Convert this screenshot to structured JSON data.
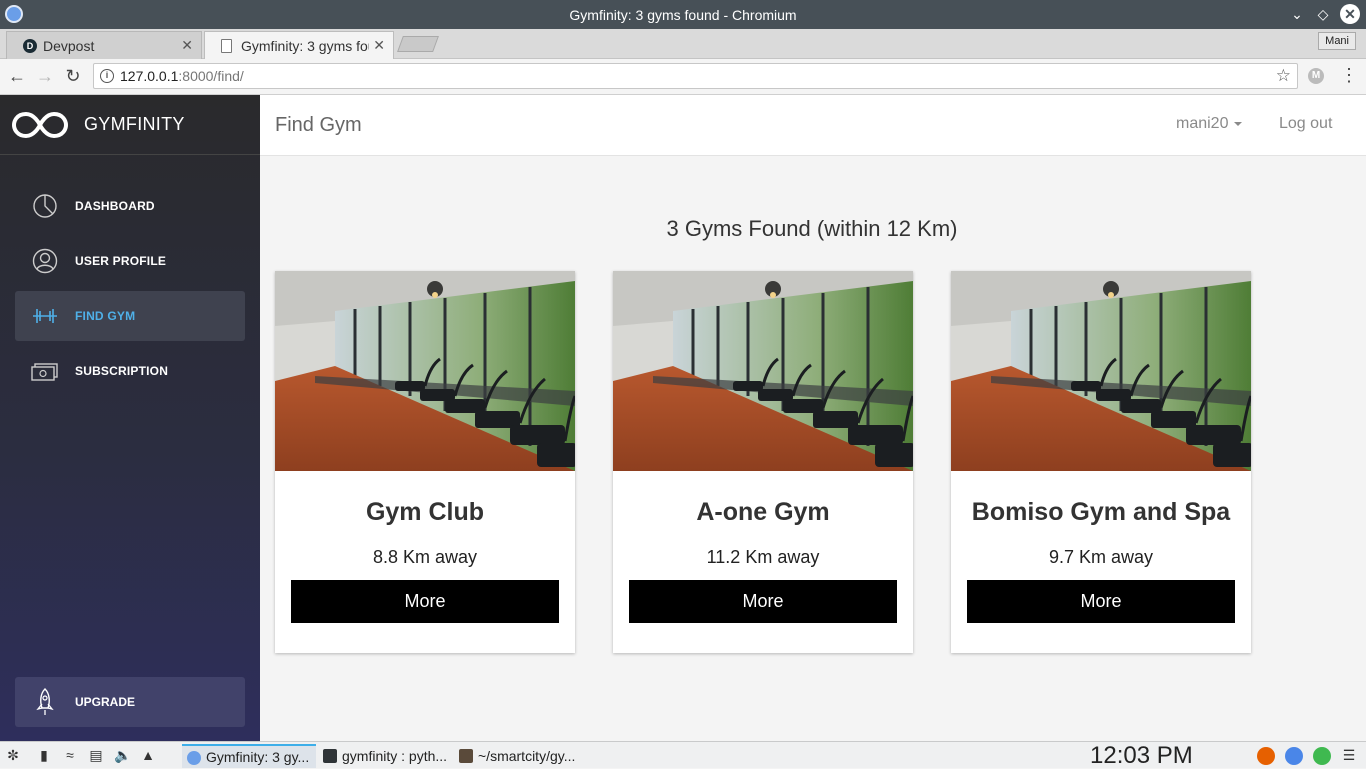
{
  "browser": {
    "window_title": "Gymfinity: 3 gyms found - Chromium",
    "profile_label": "Mani",
    "tabs": [
      {
        "label": "Devpost"
      },
      {
        "label": "Gymfinity: 3 gyms fou"
      }
    ],
    "url_host": "127.0.0.1",
    "url_path": ":8000/find/"
  },
  "app": {
    "brand": "GYMFINITY",
    "sidebar": {
      "items": [
        {
          "label": "DASHBOARD",
          "icon": "pie-chart-icon",
          "active": false
        },
        {
          "label": "USER PROFILE",
          "icon": "user-circle-icon",
          "active": false
        },
        {
          "label": "FIND GYM",
          "icon": "dumbbell-icon",
          "active": true
        },
        {
          "label": "SUBSCRIPTION",
          "icon": "money-icon",
          "active": false
        }
      ],
      "upgrade_label": "UPGRADE"
    },
    "header": {
      "title": "Find Gym",
      "username": "mani20",
      "logout_label": "Log out"
    },
    "results_title": "3 Gyms Found (within 12 Km)",
    "gyms": [
      {
        "name": "Gym Club",
        "distance": "8.8 Km away",
        "button": "More"
      },
      {
        "name": "A-one Gym",
        "distance": "11.2 Km away",
        "button": "More"
      },
      {
        "name": "Bomiso Gym and Spa",
        "distance": "9.7 Km away",
        "button": "More"
      }
    ]
  },
  "taskbar": {
    "tasks": [
      {
        "label": "Gymfinity: 3 gy..."
      },
      {
        "label": "gymfinity : pyth..."
      },
      {
        "label": "~/smartcity/gy..."
      }
    ],
    "clock": "12:03 PM"
  },
  "colors": {
    "sidebar_active_text": "#4fb0e8",
    "more_button_bg": "#000000",
    "upgrade_bg": "#41426a"
  }
}
